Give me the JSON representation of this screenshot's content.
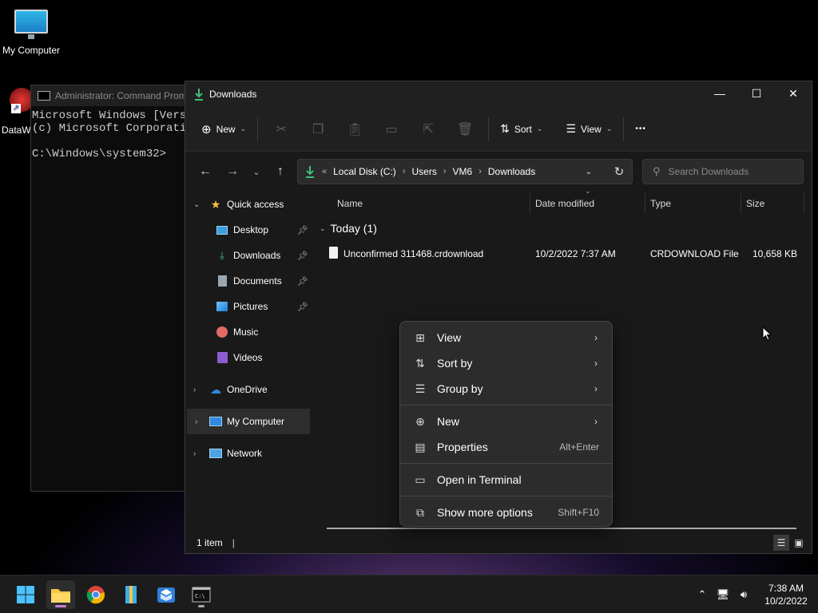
{
  "desktop": {
    "icons": [
      {
        "label": "My Computer"
      },
      {
        "label": "DataW"
      }
    ]
  },
  "cmd": {
    "title": "Administrator: Command Prom",
    "lines": [
      "Microsoft Windows [Versi",
      "(c) Microsoft Corporatio",
      "",
      "C:\\Windows\\system32>"
    ]
  },
  "explorer": {
    "title": "Downloads",
    "controls": {
      "minimize": "—",
      "maximize": "☐",
      "close": "✕"
    },
    "toolbar": {
      "new_label": "New",
      "sort_label": "Sort",
      "view_label": "View",
      "more_label": "•••"
    },
    "address": {
      "prefix": "«",
      "crumbs": [
        "Local Disk (C:)",
        "Users",
        "VM6",
        "Downloads"
      ]
    },
    "search": {
      "placeholder": "Search Downloads"
    },
    "nav": {
      "quick_access": "Quick access",
      "items": [
        {
          "label": "Desktop",
          "pinned": true
        },
        {
          "label": "Downloads",
          "pinned": true
        },
        {
          "label": "Documents",
          "pinned": true
        },
        {
          "label": "Pictures",
          "pinned": true
        },
        {
          "label": "Music",
          "pinned": false
        },
        {
          "label": "Videos",
          "pinned": false
        }
      ],
      "onedrive": "OneDrive",
      "my_computer": "My Computer",
      "network": "Network"
    },
    "columns": {
      "name": "Name",
      "date": "Date modified",
      "type": "Type",
      "size": "Size"
    },
    "group": {
      "label": "Today (1)"
    },
    "files": [
      {
        "name": "Unconfirmed 311468.crdownload",
        "date": "10/2/2022 7:37 AM",
        "type": "CRDOWNLOAD File",
        "size": "10,658 KB"
      }
    ],
    "status": {
      "count": "1 item",
      "cursor": "|"
    }
  },
  "context_menu": {
    "view": "View",
    "sort_by": "Sort by",
    "group_by": "Group by",
    "new": "New",
    "properties": "Properties",
    "properties_shortcut": "Alt+Enter",
    "open_terminal": "Open in Terminal",
    "show_more": "Show more options",
    "show_more_shortcut": "Shift+F10"
  },
  "taskbar": {
    "apps": [
      "start-icon",
      "file-explorer-icon",
      "chrome-icon",
      "archive-icon",
      "package-icon",
      "terminal-icon"
    ],
    "time": "7:38 AM",
    "date": "10/2/2022"
  },
  "colors": {
    "accent": "#4cc2ff",
    "window_bg": "#191919",
    "menu_bg": "#2c2c2c",
    "selection": "#2d2d2d"
  }
}
